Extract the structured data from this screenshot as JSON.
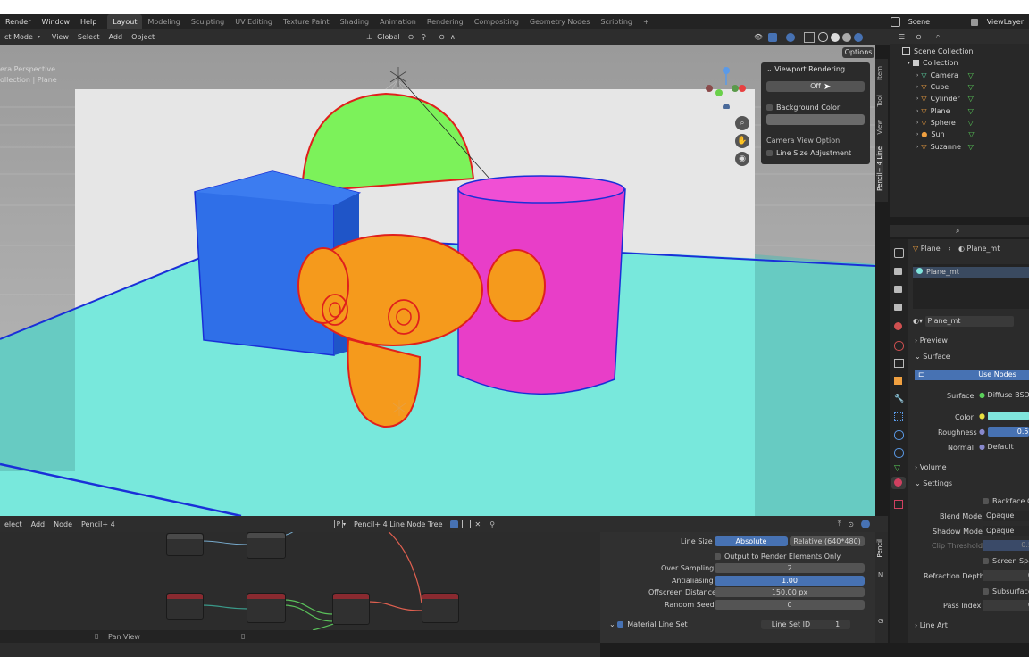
{
  "menu": {
    "items": [
      "Render",
      "Window",
      "Help"
    ]
  },
  "workspaces": {
    "tabs": [
      "Layout",
      "Modeling",
      "Sculpting",
      "UV Editing",
      "Texture Paint",
      "Shading",
      "Animation",
      "Rendering",
      "Compositing",
      "Geometry Nodes",
      "Scripting",
      "+"
    ],
    "active": "Layout"
  },
  "scene": {
    "name": "Scene",
    "view_layer": "ViewLayer"
  },
  "viewport_header": {
    "mode": "ct Mode",
    "menus": [
      "View",
      "Select",
      "Add",
      "Object"
    ],
    "orientation": "Global",
    "options_label": "Options"
  },
  "viewport": {
    "overlay_line1": "era Perspective",
    "overlay_line2": "ollection | Plane",
    "side_tabs": [
      "Item",
      "Tool",
      "View",
      "Pencil+ 4 Line"
    ]
  },
  "npanel": {
    "title": "Viewport Rendering",
    "render_toggle": "Off",
    "bg_color_label": "Background Color",
    "camera_view_option": "Camera View Option",
    "line_size_adjustment": "Line Size Adjustment"
  },
  "outliner": {
    "root": "Scene Collection",
    "collection": "Collection",
    "objects": [
      {
        "name": "Camera",
        "icon": "camera-icon"
      },
      {
        "name": "Cube",
        "icon": "mesh-icon"
      },
      {
        "name": "Cylinder",
        "icon": "mesh-icon"
      },
      {
        "name": "Plane",
        "icon": "mesh-icon"
      },
      {
        "name": "Sphere",
        "icon": "mesh-icon"
      },
      {
        "name": "Sun",
        "icon": "sun-icon"
      },
      {
        "name": "Suzanne",
        "icon": "mesh-icon"
      }
    ]
  },
  "properties": {
    "breadcrumb_object": "Plane",
    "breadcrumb_material": "Plane_mt",
    "slot_name": "Plane_mt",
    "material_name": "Plane_mt",
    "sections": {
      "preview": "Preview",
      "surface": "Surface",
      "volume": "Volume",
      "settings": "Settings",
      "line_art": "Line Art"
    },
    "use_nodes": "Use Nodes",
    "surface_label": "Surface",
    "surface_value": "Diffuse BSD",
    "color_label": "Color",
    "color_value": "#7fe5dc",
    "roughness_label": "Roughness",
    "roughness_value": "0.5",
    "normal_label": "Normal",
    "normal_value": "Default",
    "backface": "Backface C",
    "blend_mode_label": "Blend Mode",
    "blend_mode_value": "Opaque",
    "shadow_mode_label": "Shadow Mode",
    "shadow_mode_value": "Opaque",
    "clip_threshold_label": "Clip Threshold",
    "clip_threshold_value": "0.5",
    "screen_space": "Screen Spa",
    "refraction_depth_label": "Refraction Depth",
    "refraction_depth_value": "0",
    "subsurface": "Subsurface",
    "pass_index_label": "Pass Index",
    "pass_index_value": "0"
  },
  "node_editor": {
    "menus": [
      "elect",
      "Add",
      "Node",
      "Pencil+ 4"
    ],
    "tree_name": "Pencil+ 4 Line Node Tree",
    "footer": "Pan View"
  },
  "line_panel": {
    "line_size_label": "Line Size",
    "line_size_abs": "Absolute",
    "line_size_rel": "Relative (640*480)",
    "output_render_elements": "Output to Render Elements Only",
    "over_sampling_label": "Over Sampling",
    "over_sampling_value": "2",
    "antialiasing_label": "Antialiasing",
    "antialiasing_value": "1.00",
    "offscreen_label": "Offscreen Distance",
    "offscreen_value": "150.00 px",
    "random_seed_label": "Random Seed",
    "random_seed_value": "0",
    "material_line_set": "Material Line Set",
    "line_set_id_label": "Line Set ID",
    "line_set_id_value": "1",
    "side_tabs": [
      "Pencil",
      "N",
      "G"
    ]
  },
  "scene_colors": {
    "sphere": "#7cf25a",
    "cube": "#2f6fe8",
    "cylinder": "#e83ec8",
    "suzanne": "#f59a1c",
    "ground": "#78e8dc",
    "outline_red": "#e0201c",
    "outline_blue": "#1a2fd8"
  }
}
